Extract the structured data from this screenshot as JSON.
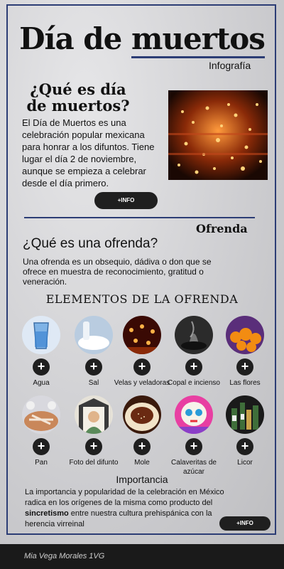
{
  "header": {
    "title_a": "Día de ",
    "title_b": "muertos",
    "subtitle": "Infografía"
  },
  "intro": {
    "question": "¿Qué es día de muertos?",
    "text": "El Día de Muertos es una celebración popular mexicana para honrar a los difuntos. Tiene lugar el día 2 de noviembre, aunque se empieza a celebrar desde el día primero.",
    "button": "+INFO"
  },
  "ofrenda": {
    "heading": "Ofrenda",
    "question": "¿Qué es una ofrenda?",
    "text": "Una ofrenda es un obsequio, dádiva o don que se ofrece en muestra de reconocimiento, gratitud o veneración."
  },
  "elements": {
    "heading": "ELEMENTOS DE LA OFRENDA",
    "plus": "+",
    "items": [
      {
        "label": "Agua",
        "icon": "water-glass-icon"
      },
      {
        "label": "Sal",
        "icon": "salt-icon"
      },
      {
        "label": "Velas y veladoras",
        "icon": "candles-icon"
      },
      {
        "label": "Copal e incienso",
        "icon": "copal-icon"
      },
      {
        "label": "Las flores",
        "icon": "marigold-icon"
      },
      {
        "label": "Pan",
        "icon": "bread-icon"
      },
      {
        "label": "Foto del difunto",
        "icon": "portrait-icon"
      },
      {
        "label": "Mole",
        "icon": "mole-icon"
      },
      {
        "label": "Calaveritas de azúcar",
        "icon": "sugar-skull-icon"
      },
      {
        "label": "Licor",
        "icon": "liquor-icon"
      }
    ]
  },
  "importance": {
    "heading": "Importancia",
    "text_a": "La importancia y popularidad de la celebración en México radica en los orígenes de la misma como producto del ",
    "text_bold": "sincretismo",
    "text_b": " entre nuestra cultura prehispánica con la herencia virreinal",
    "button": "+INFO"
  },
  "footer": {
    "author": "Mia Vega Morales 1VG"
  }
}
